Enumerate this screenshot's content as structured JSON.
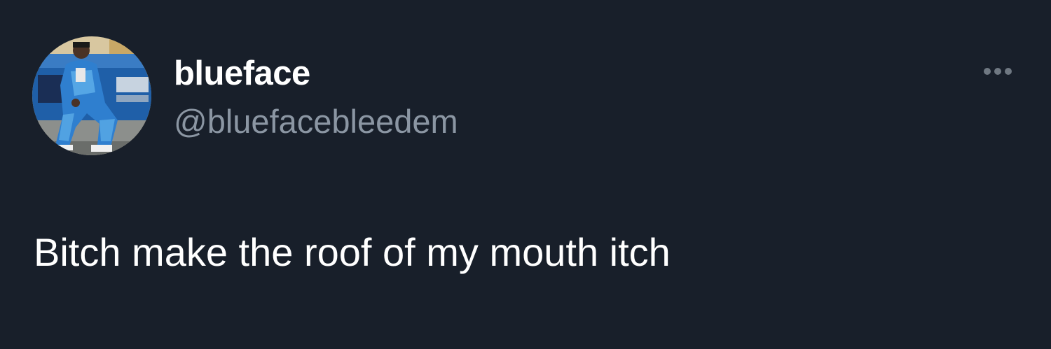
{
  "tweet": {
    "author": {
      "display_name": "blueface",
      "handle": "@bluefacebleedem"
    },
    "text": "Bitch make the roof of my mouth itch",
    "more_icon": "more-horizontal-icon"
  },
  "colors": {
    "background": "#181f2a",
    "display_name": "#ffffff",
    "handle": "#8b96a3",
    "text": "#ffffff",
    "more_icon": "#6f7882"
  }
}
